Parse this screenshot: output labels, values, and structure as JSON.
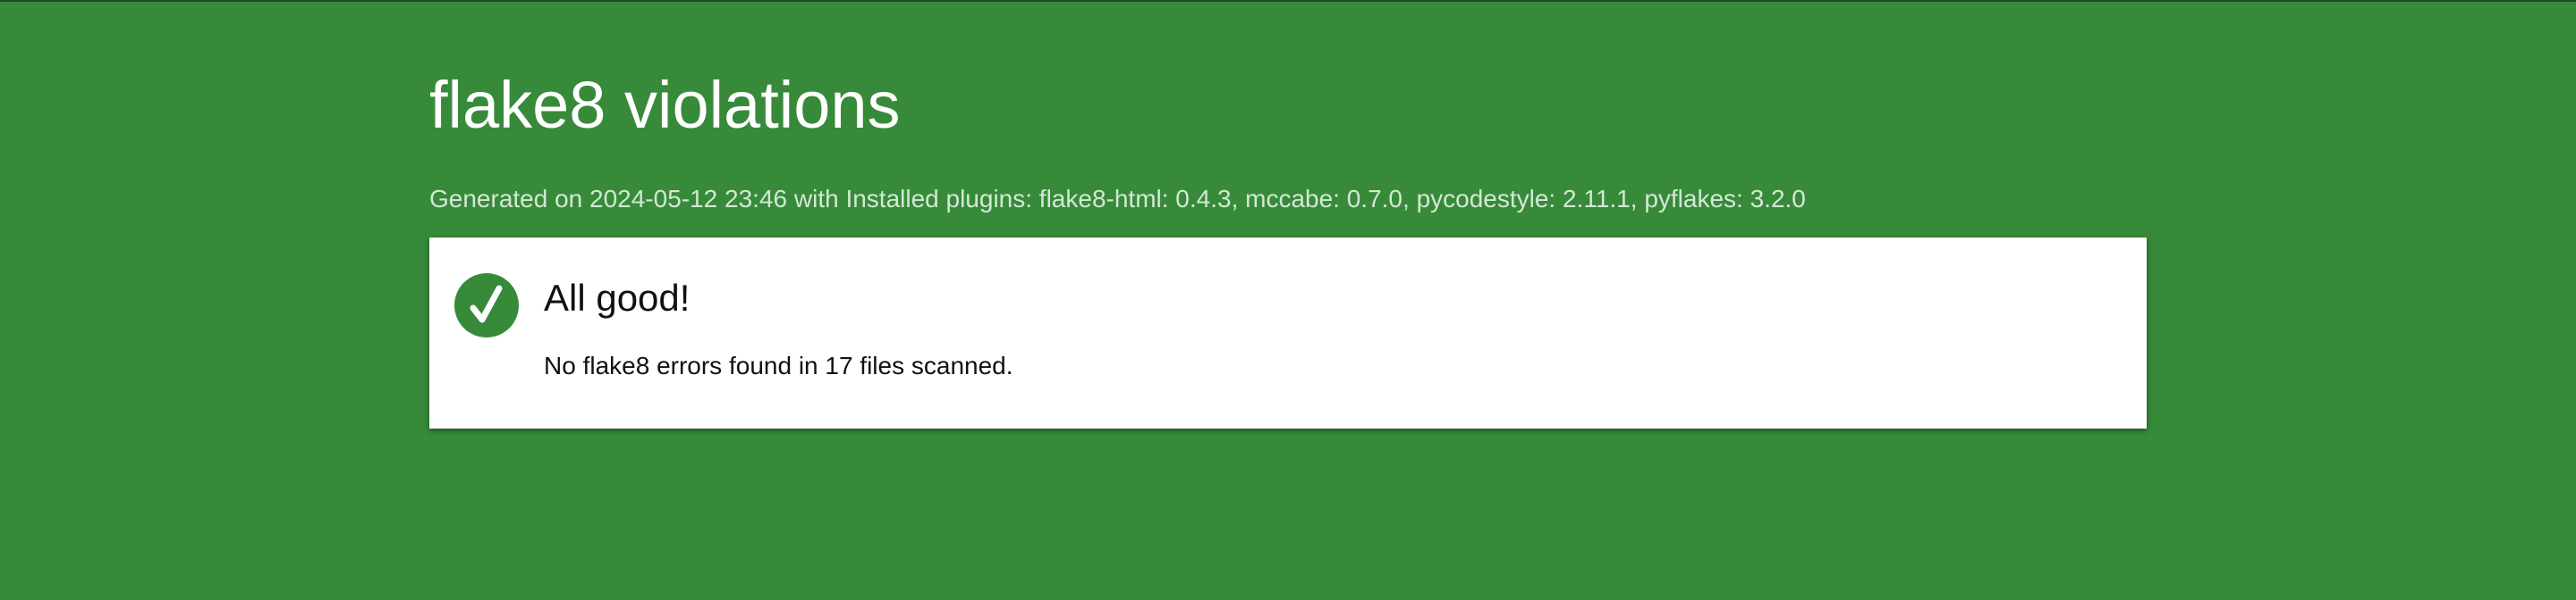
{
  "report": {
    "title": "flake8 violations",
    "generated_line": "Generated on 2024-05-12 23:46 with Installed plugins: flake8-html: 0.4.3, mccabe: 0.7.0, pycodestyle: 2.11.1, pyflakes: 3.2.0"
  },
  "result_card": {
    "icon": "check-circle-icon",
    "heading": "All good!",
    "message": "No flake8 errors found in 17 files scanned."
  },
  "colors": {
    "background": "#378a3a",
    "card_background": "#ffffff",
    "icon_circle": "#378a3a",
    "subtitle_text": "#d3e8d4"
  }
}
